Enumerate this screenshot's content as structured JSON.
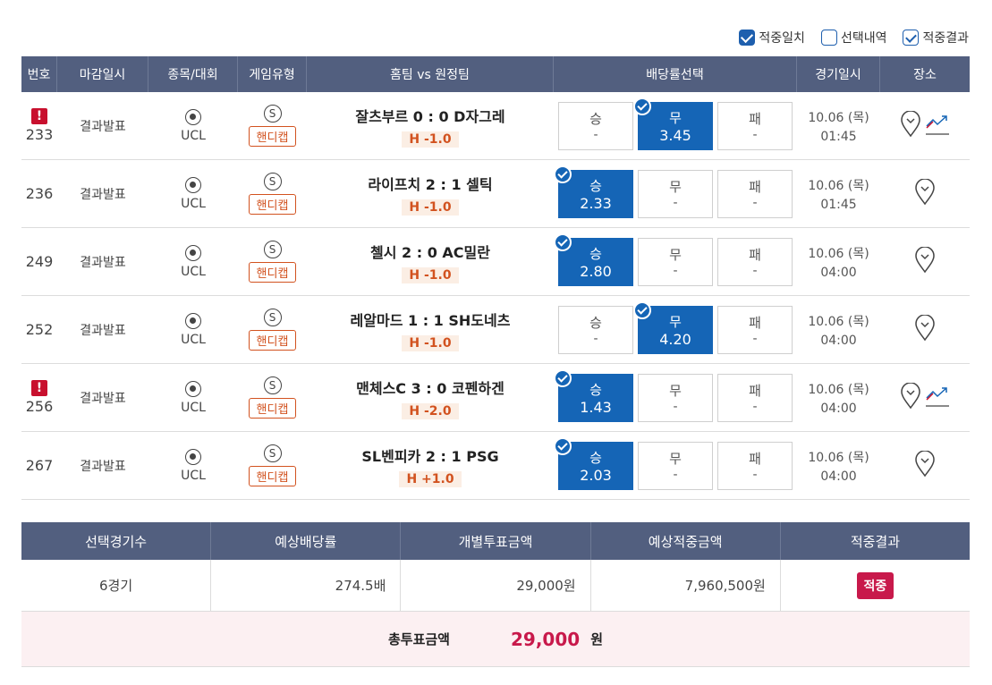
{
  "filters": [
    {
      "label": "적중일치",
      "state": "checked"
    },
    {
      "label": "선택내역",
      "state": "unchecked"
    },
    {
      "label": "적중결과",
      "state": "checked-outline"
    }
  ],
  "header": [
    "번호",
    "마감일시",
    "종목/대회",
    "게임유형",
    "홈팀 vs 원정팀",
    "배당률선택",
    "경기일시",
    "장소"
  ],
  "rows": [
    {
      "alert": true,
      "num": "233",
      "deadline": "결과발표",
      "league": "UCL",
      "s_label": "S",
      "type": "핸디캡",
      "match": "잘츠부르 0 : 0 D자그레",
      "handicap": "H -1.0",
      "odds": [
        {
          "label": "승",
          "value": "-",
          "selected": false
        },
        {
          "label": "무",
          "value": "3.45",
          "selected": true
        },
        {
          "label": "패",
          "value": "-",
          "selected": false
        }
      ],
      "date": "10.06 (목)",
      "time": "01:45",
      "chart": true
    },
    {
      "alert": false,
      "num": "236",
      "deadline": "결과발표",
      "league": "UCL",
      "s_label": "S",
      "type": "핸디캡",
      "match": "라이프치 2 : 1 셀틱",
      "handicap": "H -1.0",
      "odds": [
        {
          "label": "승",
          "value": "2.33",
          "selected": true
        },
        {
          "label": "무",
          "value": "-",
          "selected": false
        },
        {
          "label": "패",
          "value": "-",
          "selected": false
        }
      ],
      "date": "10.06 (목)",
      "time": "01:45",
      "chart": false
    },
    {
      "alert": false,
      "num": "249",
      "deadline": "결과발표",
      "league": "UCL",
      "s_label": "S",
      "type": "핸디캡",
      "match": "첼시 2 : 0 AC밀란",
      "handicap": "H -1.0",
      "odds": [
        {
          "label": "승",
          "value": "2.80",
          "selected": true
        },
        {
          "label": "무",
          "value": "-",
          "selected": false
        },
        {
          "label": "패",
          "value": "-",
          "selected": false
        }
      ],
      "date": "10.06 (목)",
      "time": "04:00",
      "chart": false
    },
    {
      "alert": false,
      "num": "252",
      "deadline": "결과발표",
      "league": "UCL",
      "s_label": "S",
      "type": "핸디캡",
      "match": "레알마드 1 : 1 SH도네츠",
      "handicap": "H -1.0",
      "odds": [
        {
          "label": "승",
          "value": "-",
          "selected": false
        },
        {
          "label": "무",
          "value": "4.20",
          "selected": true
        },
        {
          "label": "패",
          "value": "-",
          "selected": false
        }
      ],
      "date": "10.06 (목)",
      "time": "04:00",
      "chart": false
    },
    {
      "alert": true,
      "num": "256",
      "deadline": "결과발표",
      "league": "UCL",
      "s_label": "S",
      "type": "핸디캡",
      "match": "맨체스C 3 : 0 코펜하겐",
      "handicap": "H -2.0",
      "odds": [
        {
          "label": "승",
          "value": "1.43",
          "selected": true
        },
        {
          "label": "무",
          "value": "-",
          "selected": false
        },
        {
          "label": "패",
          "value": "-",
          "selected": false
        }
      ],
      "date": "10.06 (목)",
      "time": "04:00",
      "chart": true
    },
    {
      "alert": false,
      "num": "267",
      "deadline": "결과발표",
      "league": "UCL",
      "s_label": "S",
      "type": "핸디캡",
      "match": "SL벤피카 2 : 1 PSG",
      "handicap": "H +1.0",
      "odds": [
        {
          "label": "승",
          "value": "2.03",
          "selected": true
        },
        {
          "label": "무",
          "value": "-",
          "selected": false
        },
        {
          "label": "패",
          "value": "-",
          "selected": false
        }
      ],
      "date": "10.06 (목)",
      "time": "04:00",
      "chart": false
    }
  ],
  "summary": {
    "headers": [
      "선택경기수",
      "예상배당률",
      "개별투표금액",
      "예상적중금액",
      "적중결과"
    ],
    "games": "6경기",
    "odds": "274.5배",
    "bet": "29,000원",
    "expected": "7,960,500원",
    "result": "적중"
  },
  "total": {
    "label": "총투표금액",
    "amount": "29,000",
    "unit": "원"
  },
  "colors": {
    "header_bg": "#525f7f",
    "selected": "#1565b6",
    "alert": "#c8102e",
    "accent": "#c8194b",
    "handicap": "#d2521f"
  }
}
